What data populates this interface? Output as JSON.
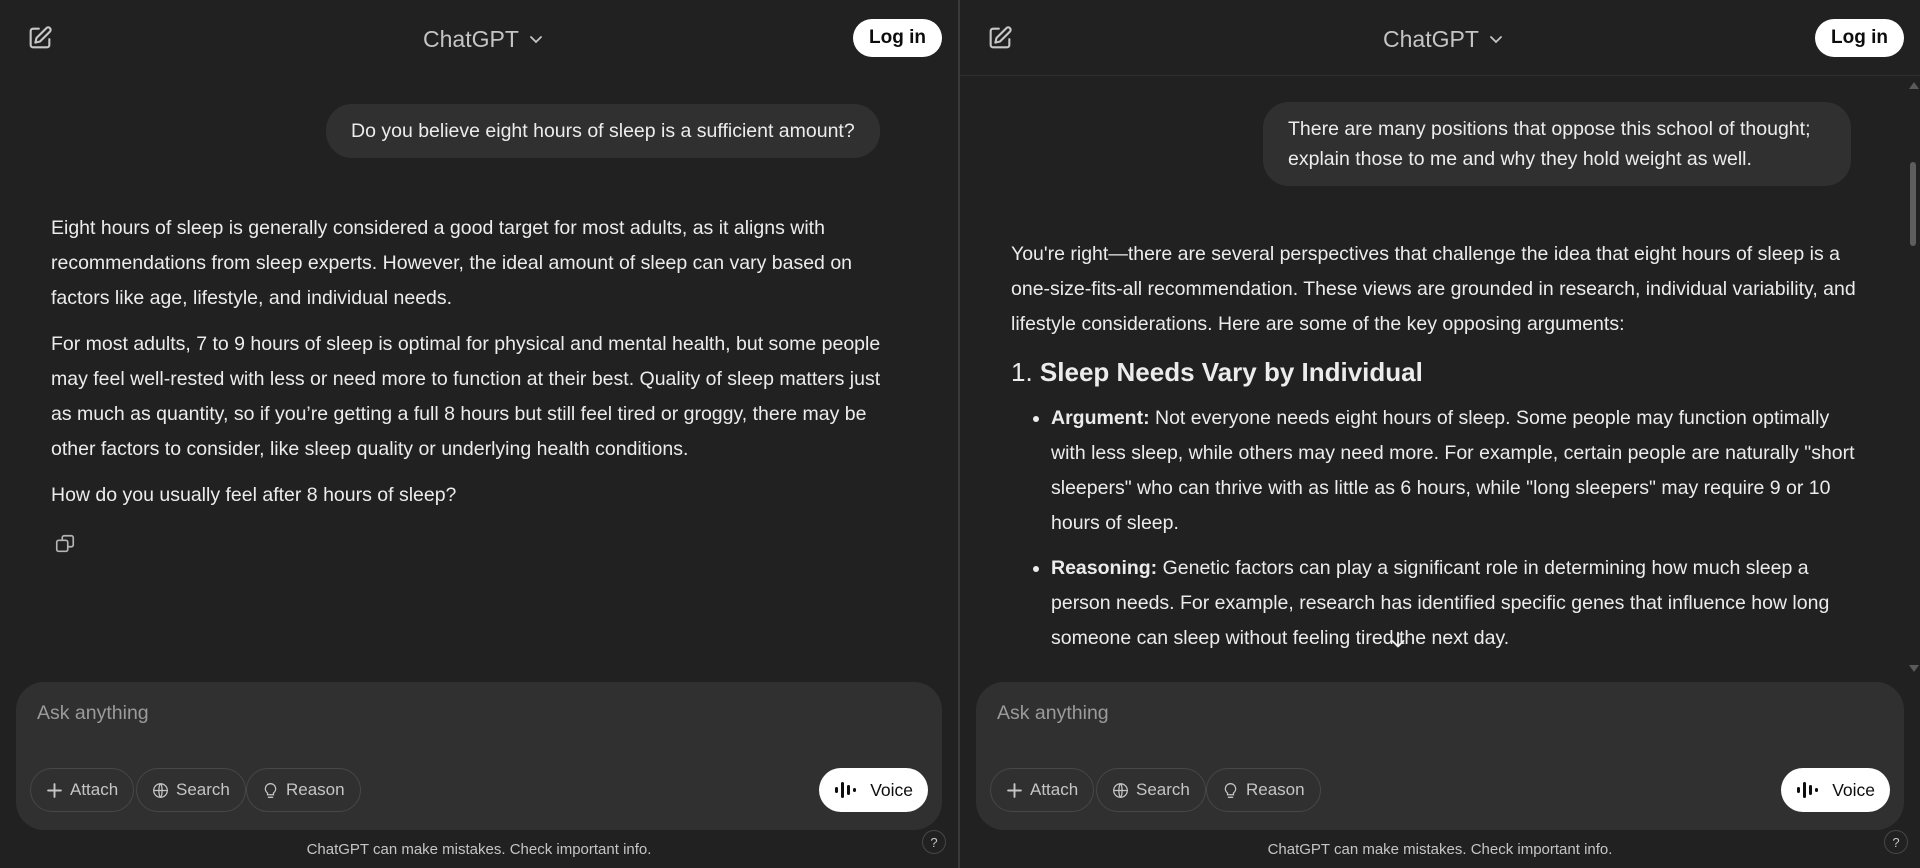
{
  "left": {
    "header": {
      "model_name": "ChatGPT",
      "login_label": "Log in"
    },
    "user_message": "Do you believe eight hours of sleep is a sufficient amount?",
    "assistant_paragraphs": [
      "Eight hours of sleep is generally considered a good target for most adults, as it aligns with recommendations from sleep experts. However, the ideal amount of sleep can vary based on factors like age, lifestyle, and individual needs.",
      "For most adults, 7 to 9 hours of sleep is optimal for physical and mental health, but some people may feel well-rested with less or need more to function at their best. Quality of sleep matters just as much as quantity, so if you’re getting a full 8 hours but still feel tired or groggy, there may be other factors to consider, like sleep quality or underlying health conditions.",
      "How do you usually feel after 8 hours of sleep?"
    ],
    "composer": {
      "placeholder": "Ask anything",
      "attach_label": "Attach",
      "search_label": "Search",
      "reason_label": "Reason",
      "voice_label": "Voice"
    },
    "disclaimer": "ChatGPT can make mistakes. Check important info.",
    "help_label": "?"
  },
  "right": {
    "header": {
      "model_name": "ChatGPT",
      "login_label": "Log in"
    },
    "user_message": "There are many positions that oppose this school of thought; explain those to me and why they hold weight as well.",
    "assistant_intro": "You're right—there are several perspectives that challenge the idea that eight hours of sleep is a one-size-fits-all recommendation. These views are grounded in research, individual variability, and lifestyle considerations. Here are some of the key opposing arguments:",
    "section_number": "1.",
    "section_title": "Sleep Needs Vary by Individual",
    "bullets": [
      {
        "label": "Argument:",
        "text": " Not everyone needs eight hours of sleep. Some people may function optimally with less sleep, while others may need more. For example, certain people are naturally \"short sleepers\" who can thrive with as little as 6 hours, while \"long sleepers\" may require 9 or 10 hours of sleep."
      },
      {
        "label": "Reasoning:",
        "text": " Genetic factors can play a significant role in determining how much sleep a person needs. For example, research has identified specific genes that influence how long someone can sleep without feeling tired the next day."
      }
    ],
    "composer": {
      "placeholder": "Ask anything",
      "attach_label": "Attach",
      "search_label": "Search",
      "reason_label": "Reason",
      "voice_label": "Voice"
    },
    "disclaimer": "ChatGPT can make mistakes. Check important info.",
    "help_label": "?"
  },
  "icons": {
    "new_chat": "new-chat-icon",
    "chevron": "chevron-down-icon",
    "copy": "copy-icon",
    "plus": "plus-icon",
    "globe": "globe-icon",
    "lightbulb": "lightbulb-icon",
    "voice": "voice-waveform-icon",
    "scroll_down": "arrow-down-icon"
  },
  "colors": {
    "background": "#212121",
    "bubble": "#303030",
    "text": "#ececec",
    "muted": "#9b9b9b"
  }
}
